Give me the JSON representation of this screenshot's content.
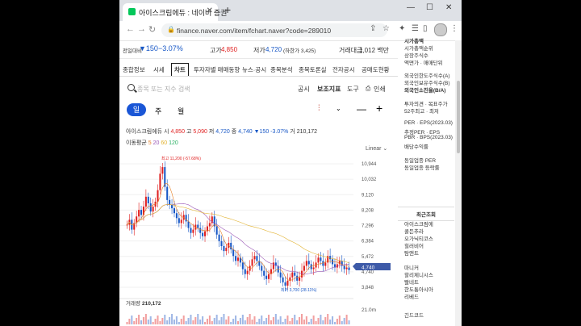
{
  "browser": {
    "tab_title": "아이스크림에듀 : 네이버 증권",
    "url": "finance.naver.com/item/fchart.naver?code=289010"
  },
  "stock": {
    "label_prev": "전일대비",
    "change_value": "▼150",
    "change_pct": "−3.07%",
    "high_label": "고가",
    "high_value": "4,850",
    "low_label": "저가",
    "low_value": "4,720",
    "low_limit": "(하한가 3,425)",
    "volume_label": "거래대금",
    "volume_value": "1,012 백만"
  },
  "tabs": [
    "종합정보",
    "시세",
    "차트",
    "투자자별 매매동향",
    "뉴스·공시",
    "종목분석",
    "종목토론실",
    "전자공시",
    "공매도현황"
  ],
  "toolbar": {
    "search_placeholder": "종목 또는 지수 검색",
    "notice": "공시",
    "indicator": "보조지표",
    "tools": "도구",
    "print": "인쇄"
  },
  "periods": {
    "day": "일",
    "week": "주",
    "month": "월"
  },
  "price_info": {
    "name": "아이스크림에듀",
    "open_l": "시",
    "open": "4,850",
    "high_l": "고",
    "high": "5,090",
    "low_l": "저",
    "low": "4,720",
    "close_l": "종",
    "close": "4,740",
    "change": "▼150 -3.07%",
    "vol_l": "거",
    "vol": "210,172"
  },
  "ma": {
    "label": "이동평균",
    "p5": "5",
    "p20": "20",
    "p60": "60",
    "p120": "120"
  },
  "scale_label": "Linear",
  "chart_data": {
    "type": "candlestick",
    "y_ticks": [
      "10,944",
      "10,032",
      "9,120",
      "8,208",
      "7,296",
      "6,384",
      "5,472",
      "4,740",
      "3,848"
    ],
    "current_price": "4,740",
    "high_annotation": "최고 11,200 (-57.68%)",
    "low_annotation": "최저 3,700 (28.11%)",
    "volume_label": "거래량",
    "volume_value": "210,172",
    "volume_tick": "21.0m",
    "closes": [
      7.5,
      7.8,
      7.2,
      7.6,
      8.0,
      8.4,
      8.1,
      8.6,
      9.2,
      8.8,
      8.3,
      8.6,
      8.9,
      9.6,
      10.6,
      11.0,
      9.8,
      9.0,
      8.7,
      8.5,
      8.2,
      7.9,
      7.6,
      7.8,
      8.1,
      7.7,
      7.3,
      7.0,
      7.2,
      7.5,
      7.3,
      7.0,
      6.8,
      7.1,
      7.4,
      7.6,
      8.0,
      7.4,
      6.9,
      6.5,
      6.2,
      5.9,
      6.1,
      6.4,
      6.0,
      5.6,
      5.3,
      5.5,
      5.2,
      4.8,
      4.5,
      4.7,
      5.0,
      5.4,
      5.6,
      5.3,
      5.0,
      4.7,
      4.4,
      4.2,
      4.5,
      4.8,
      5.2,
      5.0,
      4.6,
      4.3,
      4.0,
      3.8,
      4.1,
      4.3,
      4.6,
      4.4,
      4.1,
      4.3,
      4.7,
      5.0,
      5.3,
      5.1,
      4.8,
      4.9,
      5.2,
      5.5,
      5.3,
      5.0,
      5.2,
      5.6,
      5.4,
      5.1,
      4.9,
      5.1,
      5.3,
      5.0,
      4.8,
      4.9,
      4.74
    ]
  },
  "sidebar": {
    "items": [
      "시가총액",
      "시가총액순위",
      "상장주식수",
      "액면가 · 매매단위",
      "외국인한도주식수(A)",
      "외국인보유주식수(B)",
      "외국인소진율(B/A)",
      "투자의견 · 목표주가",
      "52주최고 · 최저",
      "PER · EPS(2023.03)",
      "추정PER · EPS",
      "PBR · BPS(2023.03)",
      "배당수익률",
      "동일업종 PER",
      "동일업종 등락률"
    ],
    "recent_title": "최근조회",
    "recent": [
      "아이스크림에",
      "콜든추라",
      "오가닉티코스",
      "힐러비어",
      "탐앤트",
      "마니커",
      "할리제니시스",
      "빨네트",
      "한도통아시아",
      "리베드"
    ],
    "bottom": "긴드코드"
  }
}
